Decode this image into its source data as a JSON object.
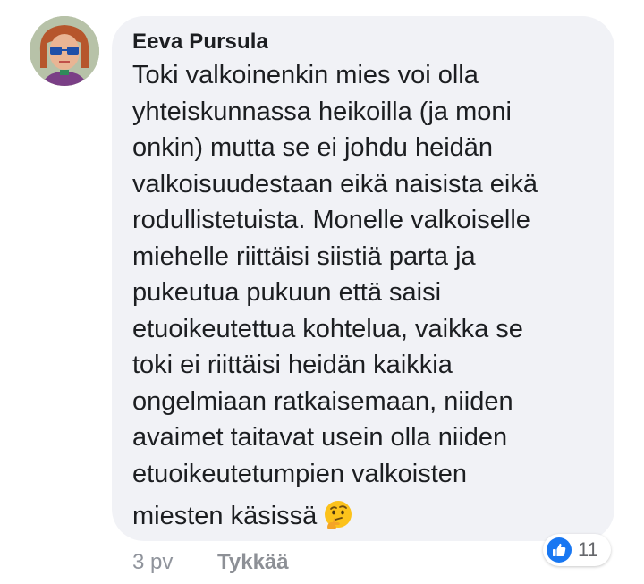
{
  "comment": {
    "author": "Eeva Pursula",
    "lines": [
      "Toki valkoinenkin mies voi olla",
      "yhteiskunnassa heikoilla (ja moni",
      "onkin) mutta se ei johdu heidän",
      "valkoisuudestaan eikä naisista eikä",
      "rodullistetuista. Monelle valkoiselle",
      "miehelle riittäisi siistiä parta ja",
      "pukeutua pukuun että saisi",
      "etuoikeutettua kohtelua, vaikka se",
      "toki ei riittäisi heidän kaikkia",
      "ongelmiaan ratkaisemaan, niiden",
      "avaimet taitavat usein olla niiden",
      "etuoikeutetumpien valkoisten",
      "miesten käsissä"
    ],
    "emoji": "thinking-face-icon",
    "time": "3 pv",
    "like_label": "Tykkää",
    "reaction_count": "11",
    "reaction_icon": "thumbs-up-icon"
  },
  "colors": {
    "bubble": "#f1f2f6",
    "text": "#1c1e21",
    "meta": "#90949c",
    "like_blue": "#1877f2"
  }
}
